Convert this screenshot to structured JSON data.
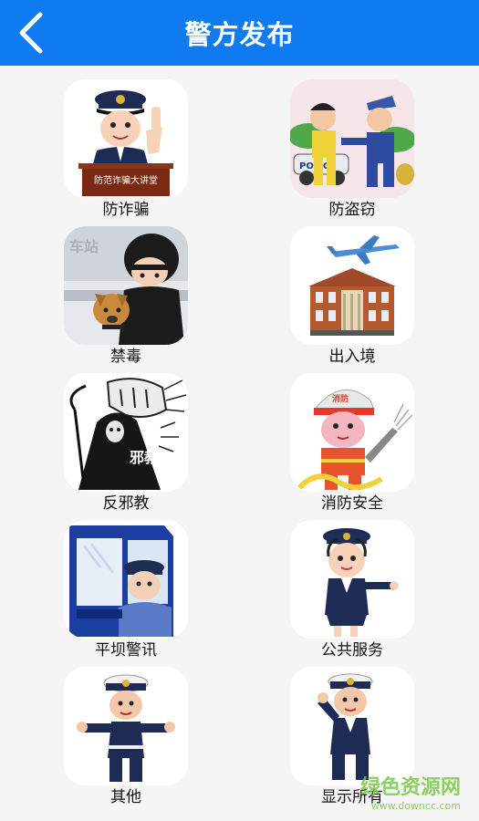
{
  "header": {
    "title": "警方发布",
    "back_icon": "chevron-left-icon",
    "background": "#0f7bf0"
  },
  "items": [
    {
      "label": "防诈骗",
      "icon": "anti-fraud-police-lecture-icon",
      "podium_text": "防范诈骗大讲堂"
    },
    {
      "label": "防盗窃",
      "icon": "anti-theft-arrest-icon",
      "car_text": "POLICE"
    },
    {
      "label": "禁毒",
      "icon": "anti-drug-police-dog-icon",
      "sign_text": "车站"
    },
    {
      "label": "出入境",
      "icon": "immigration-airplane-building-icon"
    },
    {
      "label": "反邪教",
      "icon": "anti-cult-fist-icon",
      "figure_text": "邪教"
    },
    {
      "label": "消防安全",
      "icon": "firefighter-hose-icon",
      "helmet_text": "消防"
    },
    {
      "label": "平坝警讯",
      "icon": "police-car-window-icon"
    },
    {
      "label": "公共服务",
      "icon": "policewoman-pointing-icon"
    },
    {
      "label": "其他",
      "icon": "traffic-police-icon"
    },
    {
      "label": "显示所有",
      "icon": "saluting-police-icon"
    }
  ],
  "watermark": {
    "line1": "绿色资源网",
    "line2": "www.downcc.com"
  }
}
